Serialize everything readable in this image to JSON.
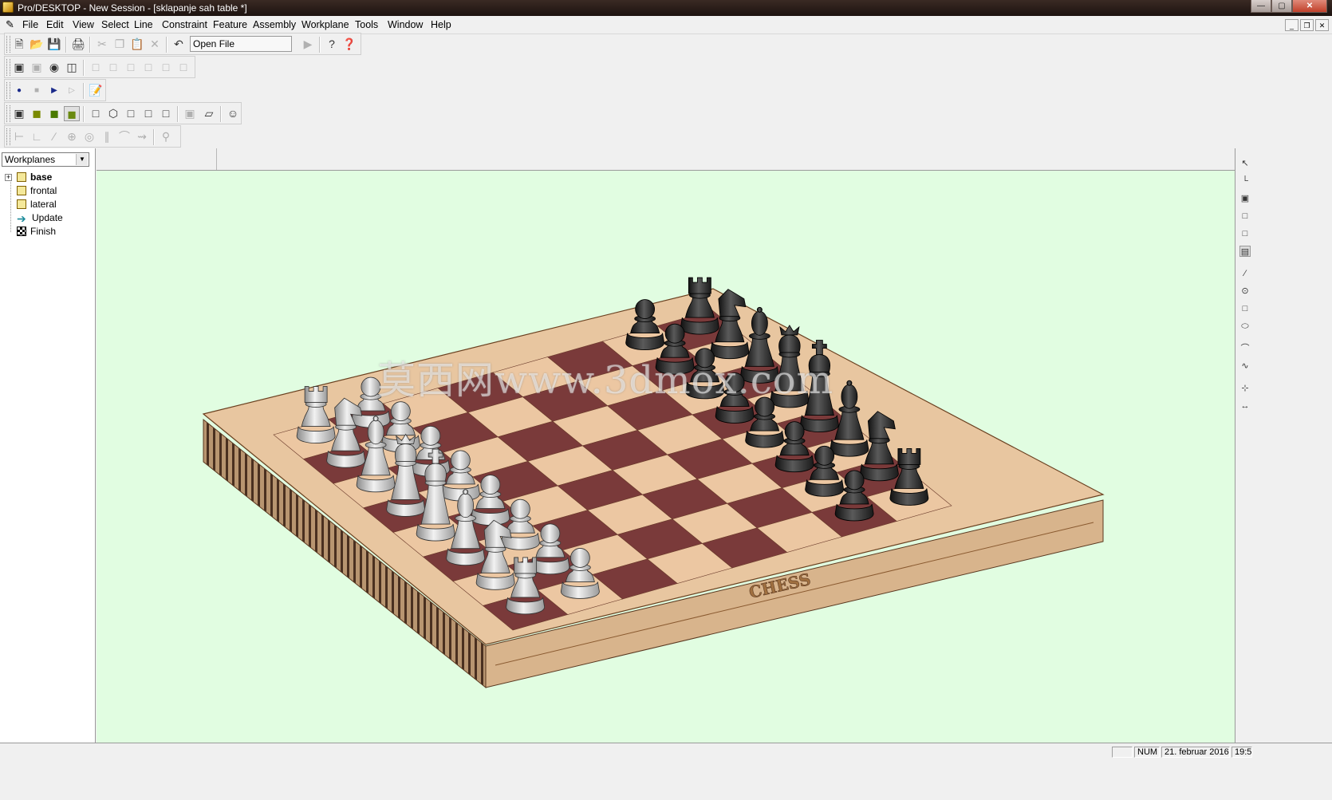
{
  "window": {
    "title": "Pro/DESKTOP - New Session - [sklapanje sah table *]"
  },
  "menu": {
    "items": [
      "File",
      "Edit",
      "View",
      "Select",
      "Line",
      "Constraint",
      "Feature",
      "Assembly",
      "Workplane",
      "Tools",
      "Window",
      "Help"
    ]
  },
  "toolbar": {
    "open_file_label": "Open File"
  },
  "browser": {
    "dropdown_value": "Workplanes",
    "items": [
      {
        "label": "base",
        "bold": true,
        "icon": "workplane-icon"
      },
      {
        "label": "frontal",
        "icon": "workplane-icon"
      },
      {
        "label": "lateral",
        "icon": "workplane-icon"
      },
      {
        "label": "Update",
        "icon": "arrow-right-icon"
      },
      {
        "label": "Finish",
        "icon": "checkered-flag-icon"
      }
    ]
  },
  "viewport": {
    "background": "#e1fde1",
    "board_label": "CHESS",
    "watermark": "莫西网www.3dmox.com"
  },
  "status": {
    "num": "NUM",
    "date": "21. februar 2016",
    "time": "19:5"
  },
  "colors": {
    "dark_square": "#7a3a3a",
    "light_square": "#ecc7a2",
    "frame": "#c8a27c",
    "white_piece": "#d9d9d9",
    "black_piece": "#2b2b2b"
  }
}
